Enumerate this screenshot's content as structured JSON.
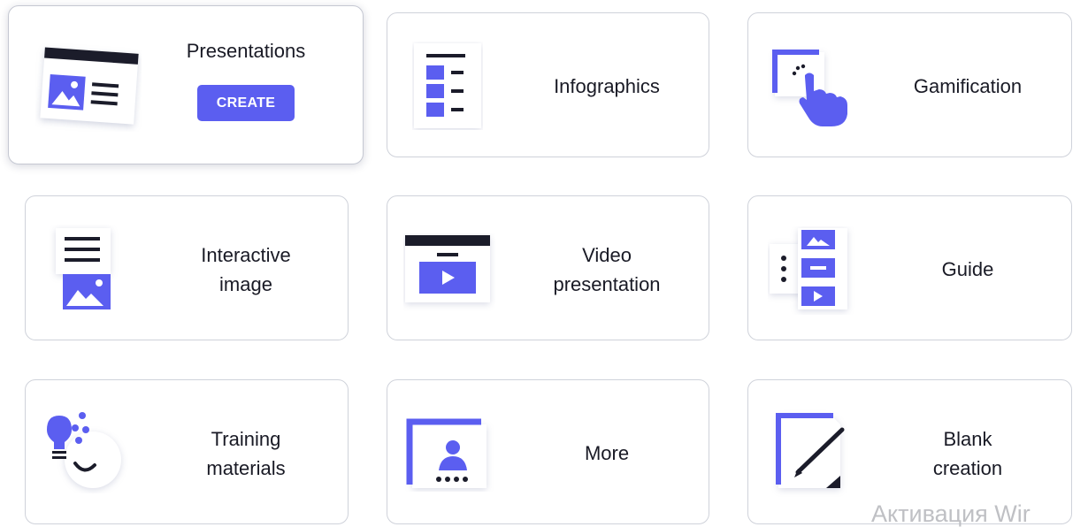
{
  "colors": {
    "accent": "#5b5ef0",
    "ink": "#191a25",
    "card_border": "#cfd2da",
    "watermark": "#bfc0c4"
  },
  "cards": [
    {
      "id": "presentations",
      "label": "Presentations",
      "icon": "presentation-slide-icon",
      "button_label": "CREATE",
      "active": true
    },
    {
      "id": "infographics",
      "label": "Infographics",
      "icon": "infographic-list-icon"
    },
    {
      "id": "gamification",
      "label": "Gamification",
      "icon": "tap-hand-icon"
    },
    {
      "id": "interactive-image",
      "label": "Interactive\nimage",
      "icon": "interactive-image-icon"
    },
    {
      "id": "video-presentation",
      "label": "Video\npresentation",
      "icon": "video-player-icon"
    },
    {
      "id": "guide",
      "label": "Guide",
      "icon": "guide-steps-icon"
    },
    {
      "id": "training-materials",
      "label": "Training\nmaterials",
      "icon": "lightbulb-smile-icon"
    },
    {
      "id": "more",
      "label": "More",
      "icon": "user-profile-icon"
    },
    {
      "id": "blank-creation",
      "label": "Blank\ncreation",
      "icon": "pencil-page-icon"
    }
  ],
  "watermark": {
    "text": "Активация Wir"
  }
}
